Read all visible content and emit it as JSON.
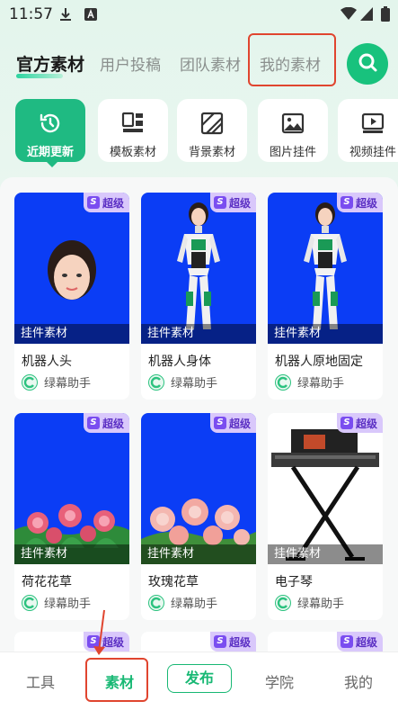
{
  "status_bar": {
    "time": "11:57",
    "icons": [
      "download-icon",
      "a-icon",
      "wifi-icon",
      "signal-icon",
      "battery-icon"
    ]
  },
  "top_tabs": [
    {
      "label": "官方素材",
      "active": true
    },
    {
      "label": "用户投稿",
      "active": false
    },
    {
      "label": "团队素材",
      "active": false
    },
    {
      "label": "我的素材",
      "active": false,
      "highlighted": true
    }
  ],
  "search": {
    "icon": "search-icon"
  },
  "categories": [
    {
      "label": "近期更新",
      "icon": "clock-refresh-icon",
      "active": true
    },
    {
      "label": "模板素材",
      "icon": "template-icon",
      "active": false
    },
    {
      "label": "背景素材",
      "icon": "background-icon",
      "active": false
    },
    {
      "label": "图片挂件",
      "icon": "image-icon",
      "active": false
    },
    {
      "label": "视频挂件",
      "icon": "video-icon",
      "active": false
    }
  ],
  "cards": [
    {
      "title": "机器人头",
      "tag": "挂件素材",
      "badge": "超级",
      "badge_letter": "S",
      "author": "绿幕助手",
      "thumb": "blue-head"
    },
    {
      "title": "机器人身体",
      "tag": "挂件素材",
      "badge": "超级",
      "badge_letter": "S",
      "author": "绿幕助手",
      "thumb": "blue-robot"
    },
    {
      "title": "机器人原地固定",
      "tag": "挂件素材",
      "badge": "超级",
      "badge_letter": "S",
      "author": "绿幕助手",
      "thumb": "blue-robot"
    },
    {
      "title": "荷花花草",
      "tag": "挂件素材",
      "badge": "超级",
      "badge_letter": "S",
      "author": "绿幕助手",
      "thumb": "blue-flowers"
    },
    {
      "title": "玫瑰花草",
      "tag": "挂件素材",
      "badge": "超级",
      "badge_letter": "S",
      "author": "绿幕助手",
      "thumb": "blue-roses"
    },
    {
      "title": "电子琴",
      "tag": "挂件素材",
      "badge": "超级",
      "badge_letter": "S",
      "author": "绿幕助手",
      "thumb": "white-keyboard"
    }
  ],
  "partial_badges": [
    {
      "badge": "超级",
      "badge_letter": "S"
    },
    {
      "badge": "超级",
      "badge_letter": "S"
    },
    {
      "badge": "超级",
      "badge_letter": "S"
    }
  ],
  "bottom_nav": [
    {
      "label": "工具",
      "active": false
    },
    {
      "label": "素材",
      "active": true,
      "highlighted": true
    },
    {
      "label": "发布",
      "active": false,
      "outlined": true
    },
    {
      "label": "学院",
      "active": false
    },
    {
      "label": "我的",
      "active": false
    }
  ],
  "colors": {
    "accent": "#18b874",
    "highlight": "#e0452f",
    "thumb_blue": "#0b3df5",
    "badge_bg": "#d9c8fb"
  }
}
